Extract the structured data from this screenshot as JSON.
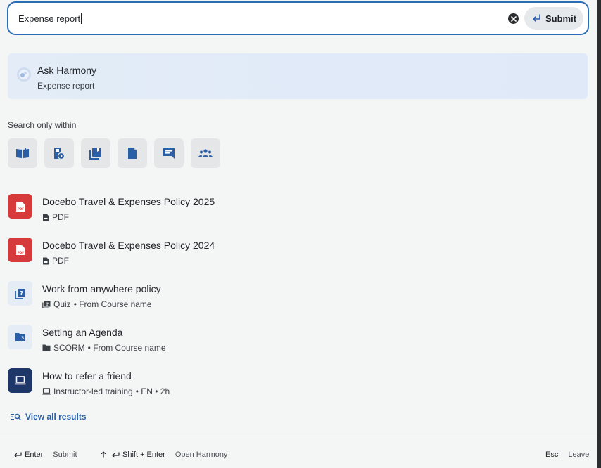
{
  "search": {
    "query": "Expense report",
    "submit_label": "Submit"
  },
  "ask": {
    "title": "Ask Harmony",
    "subtitle": "Expense report"
  },
  "filters": {
    "label": "Search only within",
    "items": [
      {
        "icon": "book-open-icon"
      },
      {
        "icon": "video-file-icon"
      },
      {
        "icon": "course-library-icon"
      },
      {
        "icon": "document-icon"
      },
      {
        "icon": "chat-icon"
      },
      {
        "icon": "people-group-icon"
      }
    ]
  },
  "results": [
    {
      "title": "Docebo Travel & Expenses Policy 2025",
      "type": "PDF",
      "meta": "",
      "icon": "pdf-icon"
    },
    {
      "title": "Docebo Travel & Expenses Policy 2024",
      "type": "PDF",
      "meta": "",
      "icon": "pdf-icon"
    },
    {
      "title": "Work from anywhere policy",
      "type": "Quiz",
      "meta": "• From Course name",
      "icon": "quiz-icon"
    },
    {
      "title": "Setting an Agenda",
      "type": "SCORM",
      "meta": "• From Course name",
      "icon": "scorm-icon"
    },
    {
      "title": "How to refer a friend",
      "type": "Instructor-led training",
      "meta": "• EN • 2h",
      "icon": "laptop-icon"
    }
  ],
  "view_all": "View all results",
  "footer": {
    "enter_key": "Enter",
    "enter_label": "Submit",
    "shift_key": "Shift + Enter",
    "shift_label": "Open Harmony",
    "esc_key": "Esc",
    "esc_label": "Leave"
  },
  "colors": {
    "accent": "#2a6fb3",
    "pdf_red": "#d63a3a",
    "navy": "#1d3769",
    "link": "#2a5fa8"
  }
}
